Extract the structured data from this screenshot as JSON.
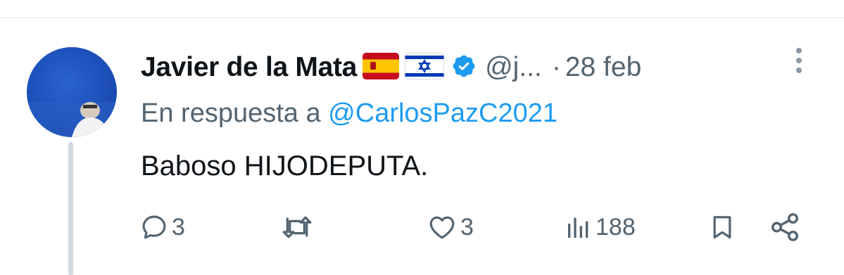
{
  "tweet": {
    "author": {
      "display_name": "Javier de la Mata",
      "flags": [
        "flag-spain-icon",
        "flag-israel-icon"
      ],
      "verified": true,
      "handle": "@j...",
      "separator": "·",
      "date": "28 feb"
    },
    "reply_context": {
      "prefix": "En respuesta a",
      "mention": "@CarlosPazC2021"
    },
    "text": "Baboso HIJODEPUTA.",
    "actions": {
      "replies": "3",
      "retweets": "",
      "likes": "3",
      "views": "188"
    }
  },
  "colors": {
    "text_primary": "#0f1419",
    "text_secondary": "#536471",
    "accent": "#1d9bf0",
    "thread_line": "#cfd9de"
  },
  "icons": [
    "more-vertical-icon",
    "verified-badge-icon",
    "reply-icon",
    "retweet-icon",
    "like-icon",
    "views-icon",
    "bookmark-icon",
    "share-icon"
  ]
}
